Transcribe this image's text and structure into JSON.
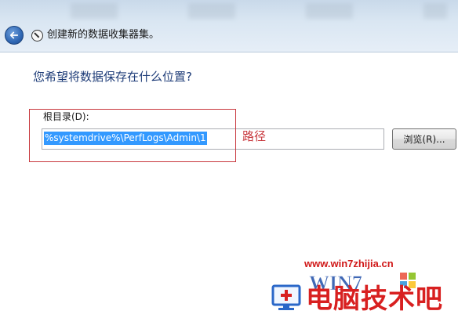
{
  "window": {
    "title": "创建新的数据收集器集。"
  },
  "page": {
    "question": "您希望将数据保存在什么位置?"
  },
  "root_dir": {
    "label": "根目录(D):",
    "value": "%systemdrive%\\PerfLogs\\Admin\\1"
  },
  "browse_button": {
    "label": "浏览(R)..."
  },
  "annotation": {
    "text": "路径",
    "color": "#c8383e"
  },
  "watermark": {
    "url": "www.win7zhijia.cn",
    "logo_text": "WIN7",
    "brand": "电脑技术吧"
  },
  "colors": {
    "accent_blue": "#1e3c78",
    "selection": "#3399ff",
    "watermark_red": "#d01818"
  },
  "icons": {
    "back": "back-arrow-icon",
    "wizard": "data-collector-set-icon"
  }
}
